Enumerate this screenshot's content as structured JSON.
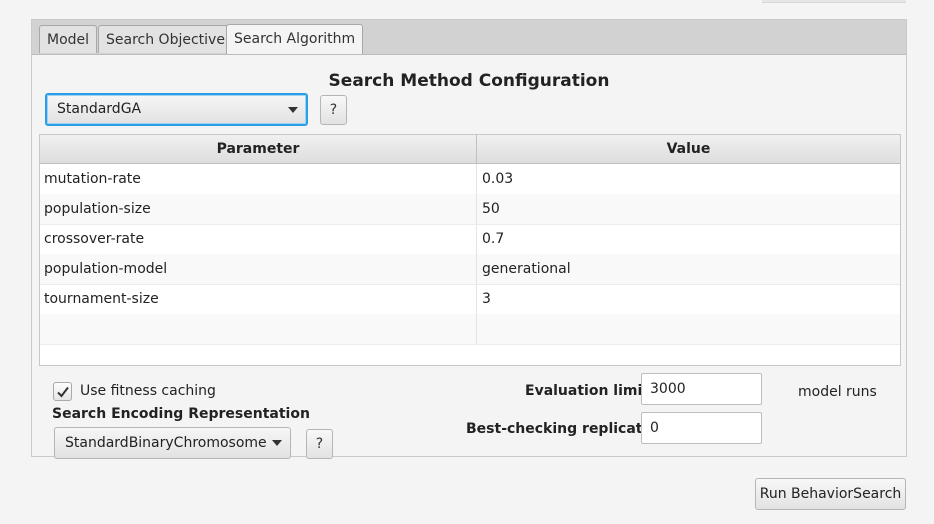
{
  "tabs": [
    {
      "label": "Model"
    },
    {
      "label": "Search Objective"
    },
    {
      "label": "Search Algorithm",
      "active": true
    }
  ],
  "section_title": "Search Method Configuration",
  "search_method": {
    "selected": "StandardGA",
    "help_label": "?"
  },
  "table": {
    "headers": [
      "Parameter",
      "Value"
    ],
    "rows": [
      {
        "parameter": "mutation-rate",
        "value": "0.03"
      },
      {
        "parameter": "population-size",
        "value": "50"
      },
      {
        "parameter": "crossover-rate",
        "value": "0.7"
      },
      {
        "parameter": "population-model",
        "value": "generational"
      },
      {
        "parameter": "tournament-size",
        "value": "3"
      }
    ]
  },
  "fitness_caching": {
    "label": "Use fitness caching",
    "checked": true
  },
  "encoding": {
    "heading": "Search Encoding Representation",
    "selected": "StandardBinaryChromosome",
    "help_label": "?"
  },
  "evaluation_limit": {
    "label": "Evaluation limit:",
    "value": "3000",
    "unit": "model runs"
  },
  "best_checking": {
    "label": "Best-checking replicates:",
    "value": "0"
  },
  "run_button": {
    "label": "Run BehaviorSearch"
  },
  "colors": {
    "focus_ring": "#2b9fe6",
    "tab_bar": "#d2d2d2"
  }
}
